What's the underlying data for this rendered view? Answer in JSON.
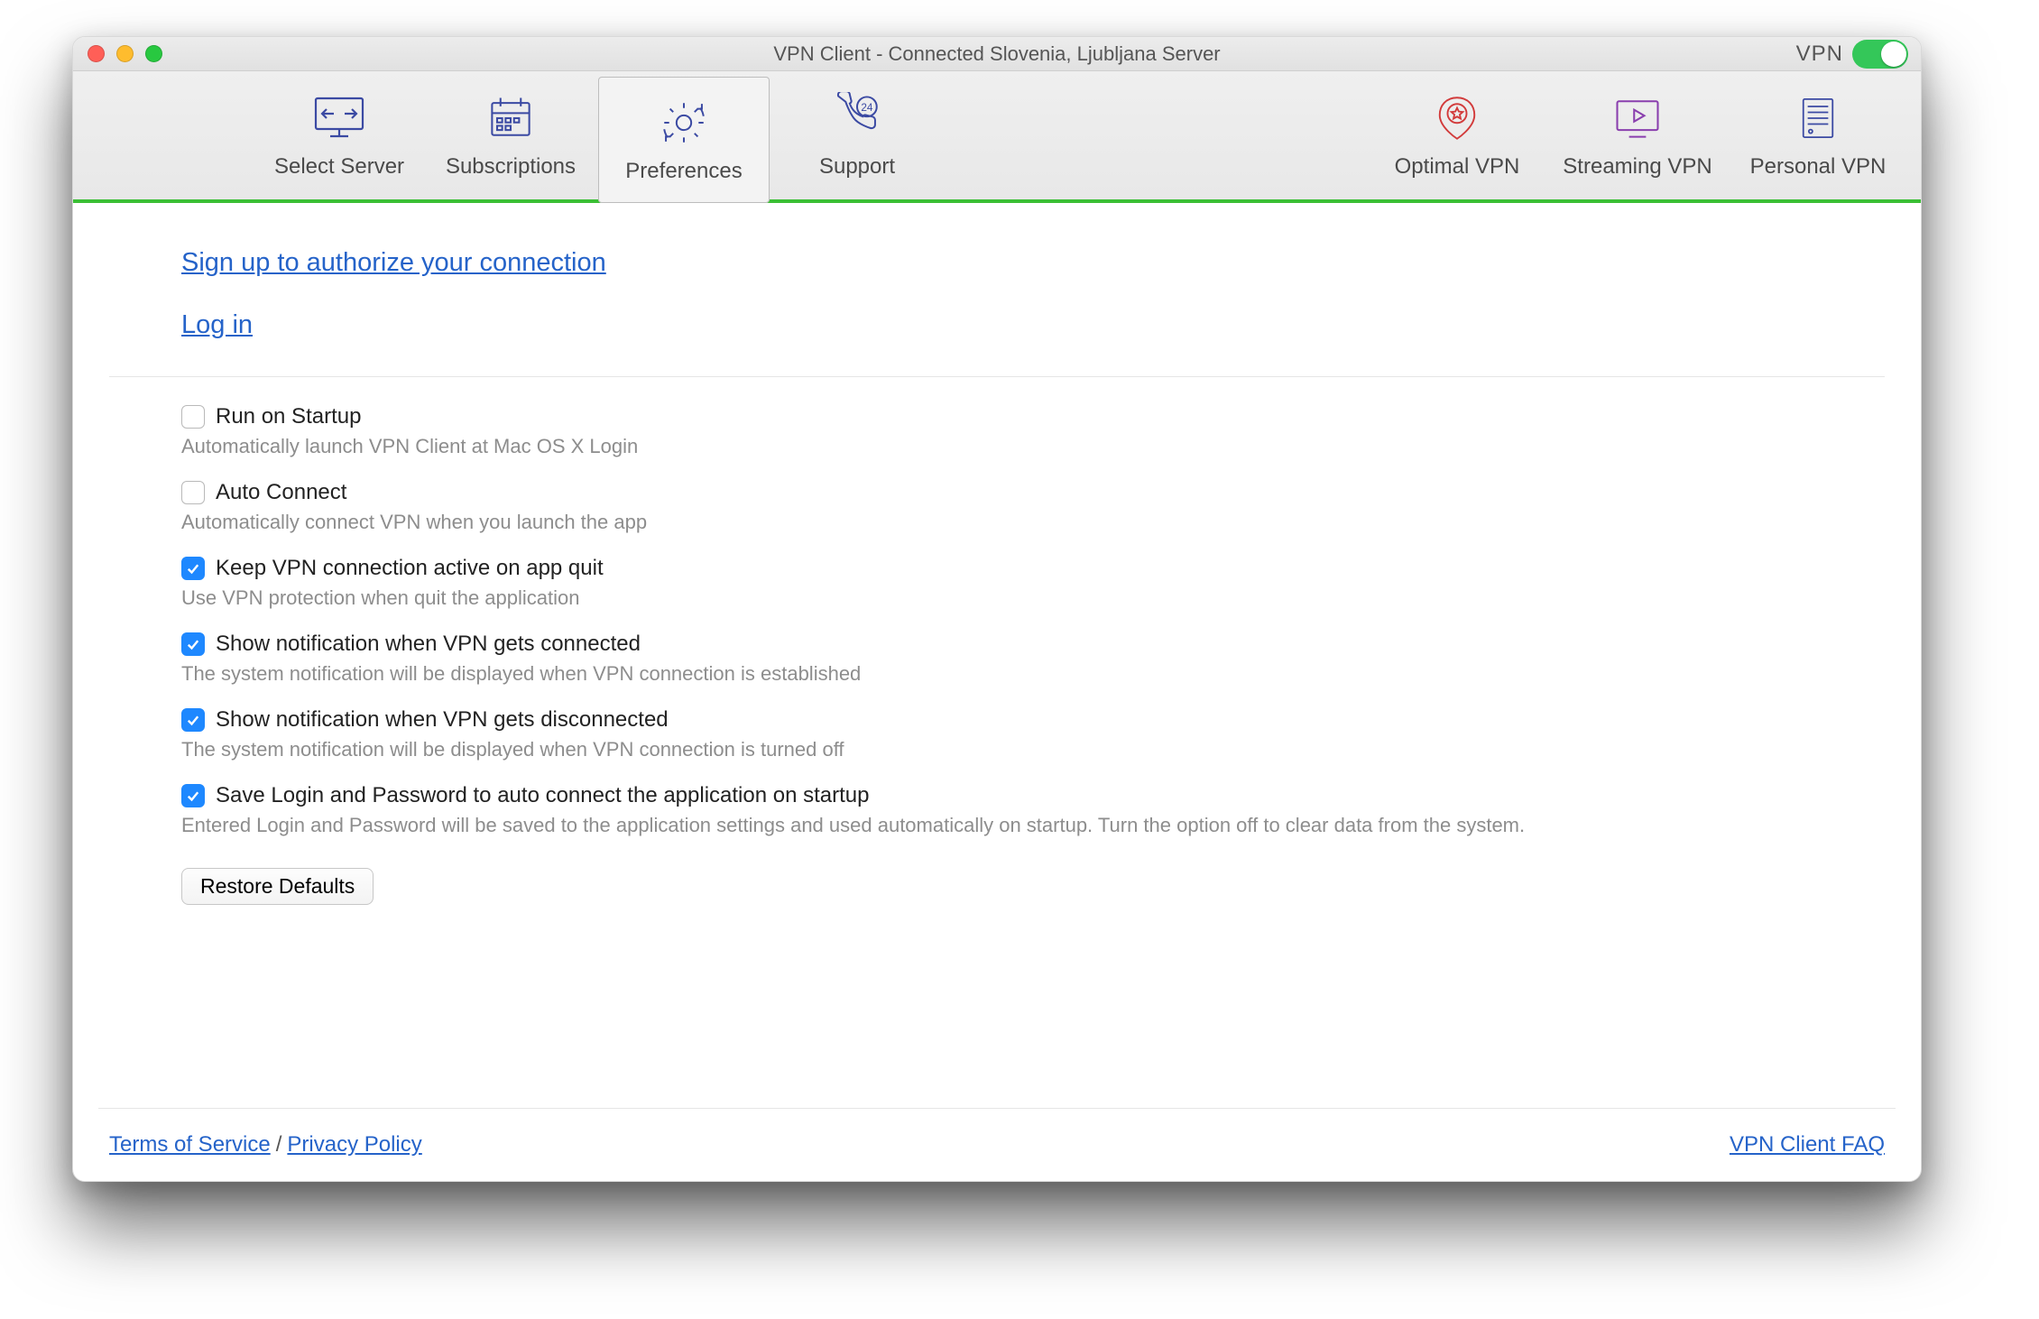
{
  "window": {
    "title": "VPN Client - Connected Slovenia, Ljubljana Server",
    "vpn_label": "VPN",
    "vpn_on": true
  },
  "toolbar": {
    "left": [
      {
        "id": "select-server",
        "label": "Select Server"
      },
      {
        "id": "subscriptions",
        "label": "Subscriptions"
      },
      {
        "id": "preferences",
        "label": "Preferences",
        "selected": true
      },
      {
        "id": "support",
        "label": "Support"
      }
    ],
    "right": [
      {
        "id": "optimal-vpn",
        "label": "Optimal VPN"
      },
      {
        "id": "streaming-vpn",
        "label": "Streaming VPN"
      },
      {
        "id": "personal-vpn",
        "label": "Personal VPN"
      }
    ]
  },
  "links": {
    "signup": "Sign up to authorize your connection",
    "login": "Log in"
  },
  "options": [
    {
      "id": "run-on-startup",
      "checked": false,
      "label": "Run on Startup",
      "desc": "Automatically launch VPN Client at Mac OS X Login"
    },
    {
      "id": "auto-connect",
      "checked": false,
      "label": "Auto Connect",
      "desc": "Automatically connect VPN when you launch the app"
    },
    {
      "id": "keep-active-on-quit",
      "checked": true,
      "label": "Keep VPN connection active on app quit",
      "desc": "Use VPN protection when quit the application"
    },
    {
      "id": "notify-connected",
      "checked": true,
      "label": "Show notification when VPN gets connected",
      "desc": "The system notification will be displayed when VPN connection is established"
    },
    {
      "id": "notify-disconnected",
      "checked": true,
      "label": "Show notification when VPN gets disconnected",
      "desc": "The system notification will be displayed when VPN connection is turned off"
    },
    {
      "id": "save-login",
      "checked": true,
      "label": "Save Login and Password to auto connect the application on startup",
      "desc": "Entered Login and Password will be saved to the application settings and used automatically on startup. Turn the option off to clear data from the system."
    }
  ],
  "buttons": {
    "restore": "Restore Defaults"
  },
  "footer": {
    "tos": "Terms of Service",
    "sep": "/",
    "privacy": "Privacy Policy",
    "faq": "VPN Client FAQ"
  }
}
